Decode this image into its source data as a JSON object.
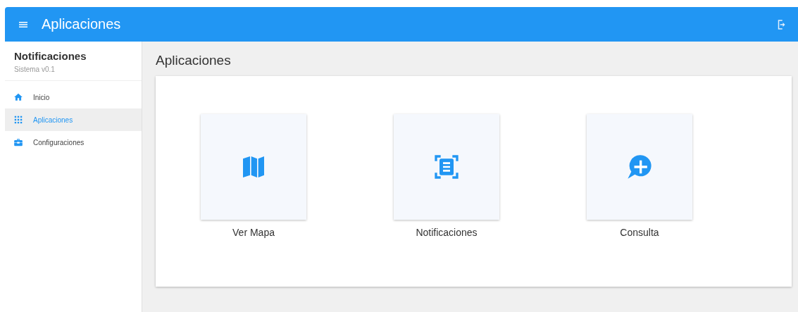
{
  "app_bar": {
    "title": "Aplicaciones"
  },
  "sidebar": {
    "title": "Notificaciones",
    "subtitle": "Sistema v0.1",
    "items": [
      {
        "label": "Inicio",
        "selected": false
      },
      {
        "label": "Aplicaciones",
        "selected": true
      },
      {
        "label": "Configuraciones",
        "selected": false
      }
    ]
  },
  "page": {
    "heading": "Aplicaciones",
    "tiles": [
      {
        "label": "Ver Mapa"
      },
      {
        "label": "Notificaciones"
      },
      {
        "label": "Consulta"
      }
    ]
  }
}
